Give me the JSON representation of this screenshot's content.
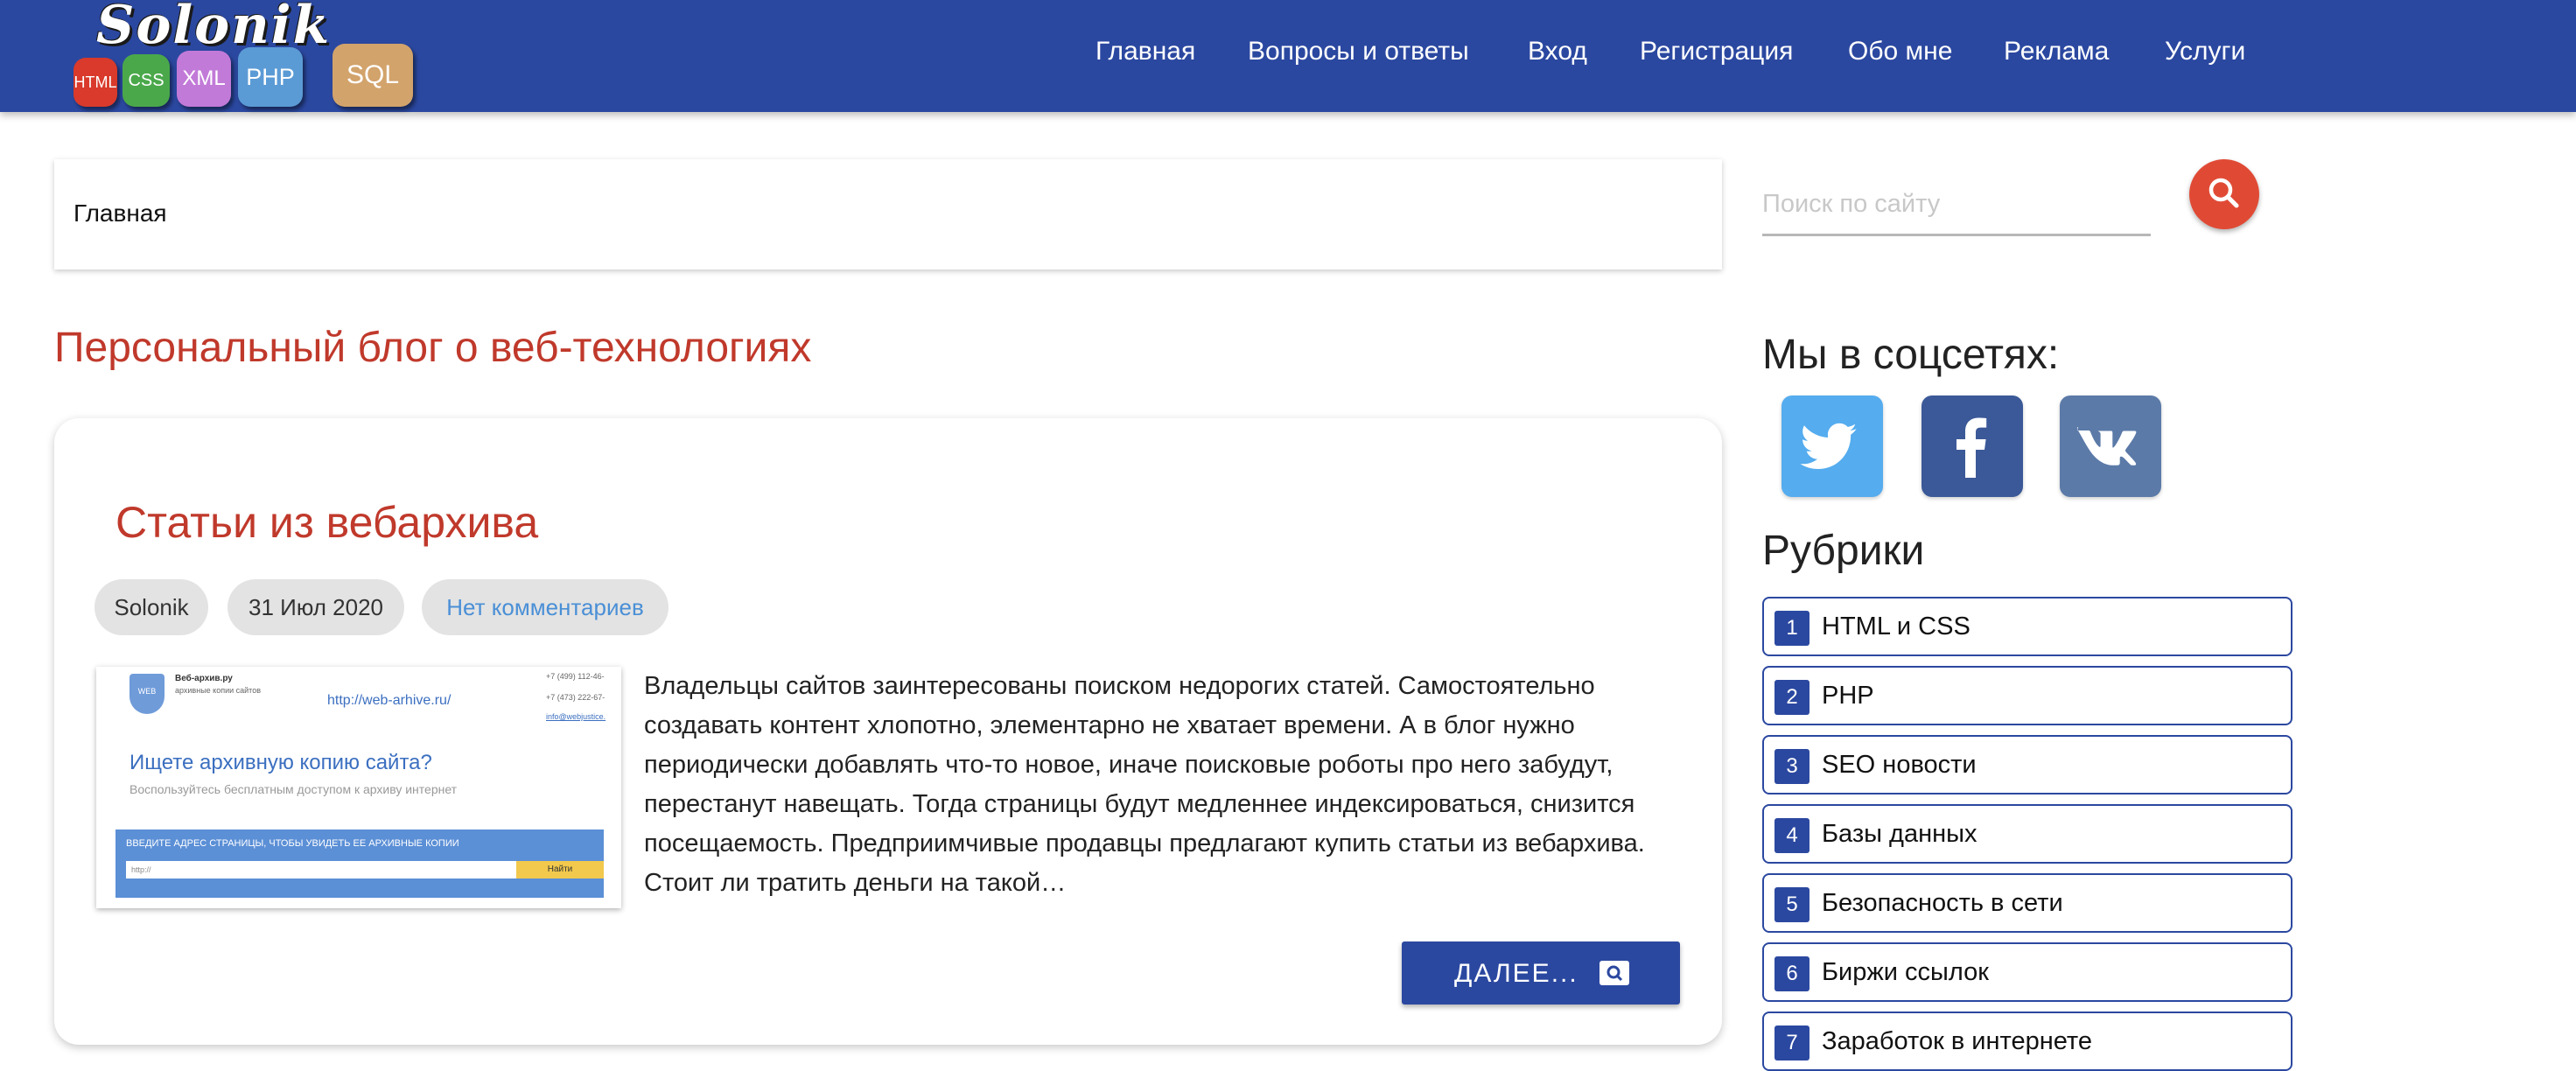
{
  "header": {
    "logo": {
      "title": "Solonik",
      "tiles": [
        {
          "label": "HTML",
          "color": "#d93a2b"
        },
        {
          "label": "CSS",
          "color": "#4aa84a"
        },
        {
          "label": "XML",
          "color": "#c27ad8"
        },
        {
          "label": "PHP",
          "color": "#5b9bd5"
        },
        {
          "label": "SQL",
          "color": "#d2a36b"
        }
      ]
    },
    "nav": [
      "Главная",
      "Вопросы и ответы",
      "Вход",
      "Регистрация",
      "Обо мне",
      "Реклама",
      "Услуги"
    ]
  },
  "breadcrumb": "Главная",
  "main": {
    "page_title": "Персональный блог о веб-технологиях",
    "post": {
      "title": "Статьи из вебархива",
      "author": "Solonik",
      "date": "31 Июл 2020",
      "comments": "Нет комментариев",
      "thumbnail": {
        "site_name": "Веб-архив.ру",
        "site_tagline": "архивные копии сайтов",
        "phone1": "+7 (499) 112-46-",
        "phone2": "+7 (473) 222-67-",
        "email": "info@webjustice.",
        "url": "http://web-arhive.ru/",
        "headline": "Ищете архивную копию сайта?",
        "subline": "Воспользуйтесь бесплатным доступом к архиву интернет",
        "band_text": "ВВЕДИТЕ АДРЕС СТРАНИЦЫ, ЧТОБЫ УВИДЕТЬ ЕЕ АРХИВНЫЕ КОПИИ",
        "input_placeholder": "http://",
        "button": "Найти"
      },
      "excerpt": "Владельцы сайтов заинтересованы поиском недорогих статей. Самостоятельно создавать контент хлопотно, элементарно не хватает времени. А в блог нужно периодически добавлять что-то новое, иначе поисковые роботы про него забудут, перестанут навещать. Тогда страницы будут медленнее индексироваться, снизится посещаемость. Предприимчивые продавцы предлагают купить статьи из вебархива. Стоит ли тратить деньги на такой…",
      "more_label": "ДАЛЕЕ..."
    }
  },
  "sidebar": {
    "search_placeholder": "Поиск по сайту",
    "social_heading": "Мы в соцсетях:",
    "social": [
      {
        "icon": "twitter-icon",
        "color": "#55acee"
      },
      {
        "icon": "facebook-icon",
        "color": "#3b5998"
      },
      {
        "icon": "vk-icon",
        "color": "#5b7aa8"
      }
    ],
    "categories_heading": "Рубрики",
    "categories": [
      {
        "num": "1",
        "label": "HTML и CSS"
      },
      {
        "num": "2",
        "label": "PHP"
      },
      {
        "num": "3",
        "label": "SEO новости"
      },
      {
        "num": "4",
        "label": "Базы данных"
      },
      {
        "num": "5",
        "label": "Безопасность в сети"
      },
      {
        "num": "6",
        "label": "Биржи ссылок"
      },
      {
        "num": "7",
        "label": "Заработок в интернете"
      }
    ]
  }
}
